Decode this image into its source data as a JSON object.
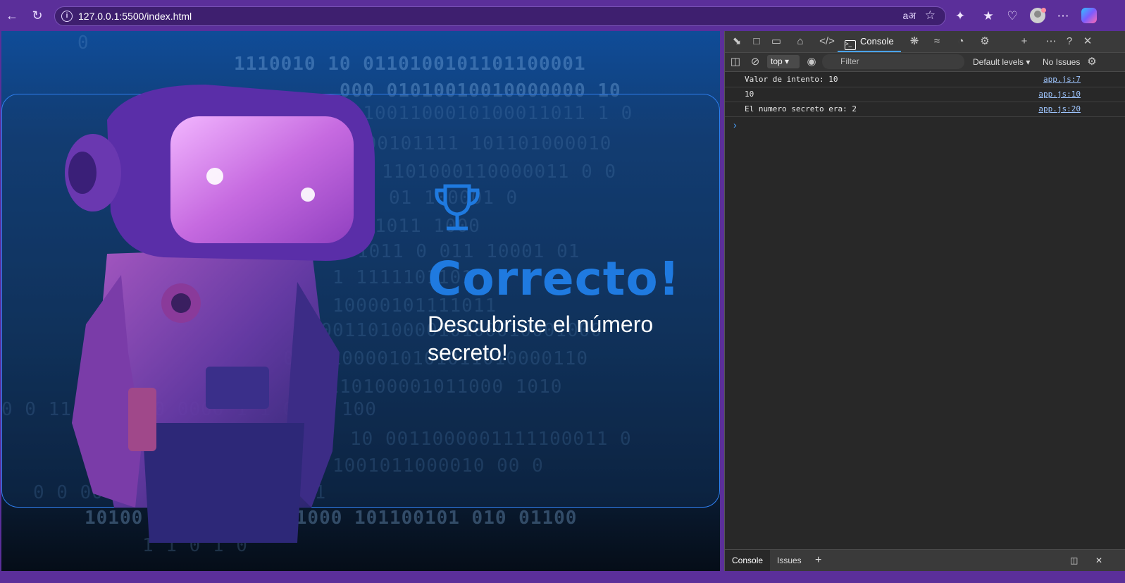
{
  "browser": {
    "url": "127.0.0.1:5500/index.html"
  },
  "page": {
    "binary_rows": [
      "0",
      "1110010 10 0110100101101100001",
      "000 01010010010000000 10",
      "0 1001100010100011011 1 0",
      "000101111  101101000010",
      "01 1101000110000011 0 0",
      "01 100001 0",
      "1011 1000",
      "1011 0 011 10001 01",
      "1 1111101101",
      "10000101111011",
      "10001101000010100010001000",
      "01101000010101011010000110",
      "01110100001011000 1010",
      "0 0 11 1011 10 0000 1 1 0 11 100",
      "10 0011000001111100011 0",
      "1001011000010 00 0",
      "0 0 00000 110000101 11011",
      "10100 010 11 101101000 101100101 010 01100",
      "1 1 0 1 0"
    ],
    "headline": "Correcto!",
    "subtitle": "Descubriste el número secreto!"
  },
  "devtools": {
    "main_tab": "Console",
    "context": "top",
    "filter_placeholder": "Filter",
    "levels": "Default levels",
    "issues": "No Issues",
    "logs": [
      {
        "message": "Valor de intento: 10",
        "source": "app.js:7"
      },
      {
        "message": "10",
        "source": "app.js:10"
      },
      {
        "message": "El numero secreto era: 2",
        "source": "app.js:20"
      }
    ],
    "bottom_tabs": [
      "Console",
      "Issues"
    ]
  }
}
